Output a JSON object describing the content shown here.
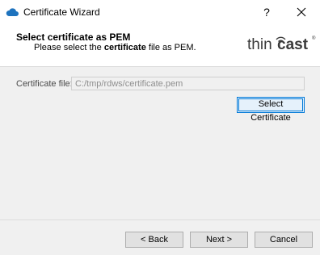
{
  "window": {
    "title": "Certificate Wizard",
    "help_label": "?",
    "close_label": "✕"
  },
  "header": {
    "title": "Select certificate as PEM",
    "subtitle_prefix": "Please select the ",
    "subtitle_bold": "certificate",
    "subtitle_suffix": " file as PEM.",
    "logo_text_left": "thin",
    "logo_text_right": "cast",
    "logo_mark": "®"
  },
  "form": {
    "file_label": "Certificate file:",
    "file_value": "C:/tmp/rdws/certificate.pem",
    "select_button": "Select Certificate"
  },
  "footer": {
    "back": "< Back",
    "next": "Next >",
    "cancel": "Cancel"
  }
}
